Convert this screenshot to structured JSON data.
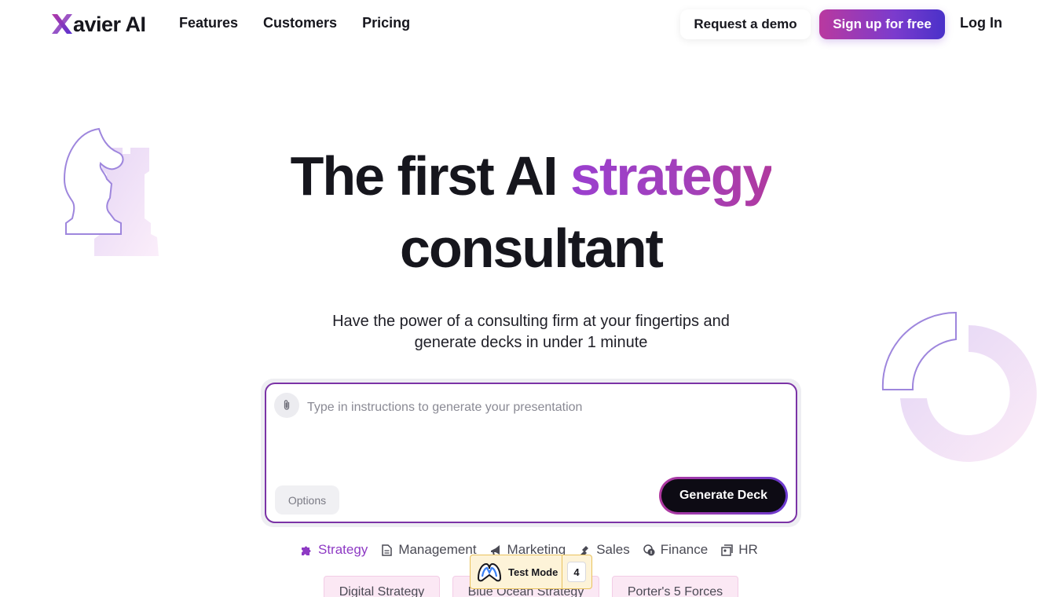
{
  "header": {
    "logo_text": "avier AI",
    "nav": [
      {
        "label": "Features"
      },
      {
        "label": "Customers"
      },
      {
        "label": "Pricing"
      }
    ],
    "request_demo_label": "Request a demo",
    "signup_label": "Sign up for free",
    "login_label": "Log In"
  },
  "hero": {
    "title_part1": "The first AI ",
    "title_accent": "strategy",
    "title_line2": "consultant",
    "subtitle_line1": "Have the power of a consulting firm at your fingertips and",
    "subtitle_line2": "generate decks in under 1 minute"
  },
  "prompt": {
    "placeholder": "Type in instructions to generate your presentation",
    "value": "",
    "options_label": "Options",
    "generate_label": "Generate Deck"
  },
  "categories": [
    {
      "label": "Strategy",
      "icon": "puzzle-icon",
      "active": true
    },
    {
      "label": "Management",
      "icon": "document-icon",
      "active": false
    },
    {
      "label": "Marketing",
      "icon": "megaphone-icon",
      "active": false
    },
    {
      "label": "Sales",
      "icon": "handshake-icon",
      "active": false
    },
    {
      "label": "Finance",
      "icon": "coins-icon",
      "active": false
    },
    {
      "label": "HR",
      "icon": "people-icon",
      "active": false
    }
  ],
  "suggestions": [
    {
      "label": "Digital Strategy"
    },
    {
      "label": "Blue Ocean Strategy"
    },
    {
      "label": "Porter's 5 Forces"
    }
  ],
  "test_mode": {
    "label": "Test Mode",
    "count": "4"
  },
  "colors": {
    "accent_purple": "#9a3fcf",
    "accent_magenta": "#b0399f",
    "signup_gradient_end": "#4a31c9",
    "prompt_border": "#7b33a6"
  }
}
